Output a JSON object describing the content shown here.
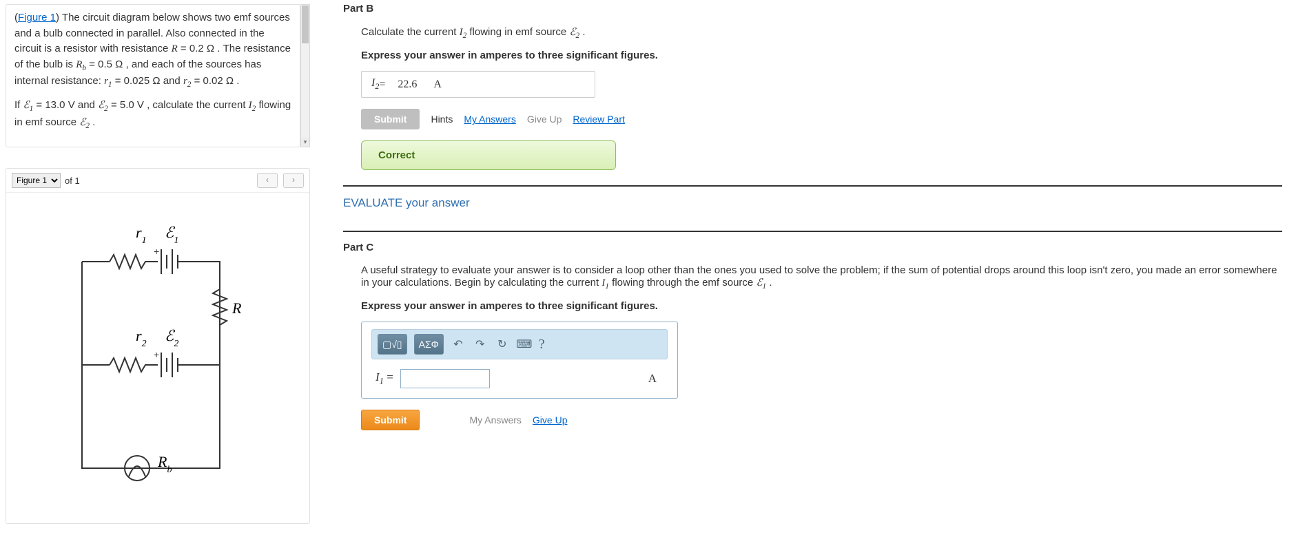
{
  "problem": {
    "figure_link": "Figure 1",
    "para1_a": ") The circuit diagram below shows two emf sources and a bulb connected in parallel. Also connected in the circuit is a resistor with resistance ",
    "R": "R",
    "eqR": " = 0.2 ",
    "ohm": "Ω",
    "para1_b": " . The resistance of the bulb is ",
    "Rb": "R",
    "Rb_sub": "b",
    "eqRb": " = 0.5 ",
    "para1_c": " , and each of the sources has internal resistance: ",
    "r1": "r",
    "r1_sub": "1",
    "eqr1": " = 0.025 ",
    "and": " and ",
    "r2": "r",
    "r2_sub": "2",
    "eqr2": " = 0.02 ",
    "period": " .",
    "para2_a": "If ",
    "E1": "ℰ",
    "E1_sub": "1",
    "eqE1": " = 13.0 V",
    "and2": " and ",
    "E2": "ℰ",
    "E2_sub": "2",
    "eqE2": " = 5.0 V",
    "para2_b": " , calculate the current ",
    "I2": "I",
    "I2_sub": "2",
    "para2_c": " flowing in emf source ",
    "E2b": "ℰ",
    "E2b_sub": "2",
    "period2": " ."
  },
  "figure": {
    "select_value": "Figure 1",
    "of_text": "of 1",
    "prev": "‹",
    "next": "›",
    "labels": {
      "r1": "r₁",
      "E1": "ℰ₁",
      "r2": "r₂",
      "E2": "ℰ₂",
      "R": "R",
      "Rb": "R_b"
    }
  },
  "partB": {
    "title": "Part B",
    "instruction_a": "Calculate the current ",
    "I2": "I",
    "I2_sub": "2",
    "instruction_b": " flowing in emf source ",
    "E2": "ℰ",
    "E2_sub": "2",
    "period": " .",
    "bold": "Express your answer in amperes to three significant figures.",
    "ans_var": "I",
    "ans_sub": "2",
    "equals": " = ",
    "ans_value": "22.6",
    "ans_unit": "A",
    "submit": "Submit",
    "hints": "Hints",
    "my_answers": "My Answers",
    "give_up": "Give Up",
    "review": "Review Part",
    "correct": "Correct"
  },
  "evaluate": "EVALUATE your answer",
  "partC": {
    "title": "Part C",
    "para_a": "A useful strategy to evaluate your answer is to consider a loop other than the ones you used to solve the problem; if the sum of potential drops around this loop isn't zero, you made an error somewhere in your calculations. Begin by calculating the current ",
    "I1": "I",
    "I1_sub": "1",
    "para_b": " flowing through the emf source ",
    "E1": "ℰ",
    "E1_sub": "1",
    "period": " .",
    "bold": "Express your answer in amperes to three significant figures.",
    "toolbar": {
      "templates": "▢√▯",
      "greek": "ΑΣΦ",
      "undo": "↶",
      "redo": "↷",
      "reset": "↻",
      "keyboard": "⌨",
      "help": "?"
    },
    "ans_var": "I",
    "ans_sub": "1",
    "equals": " = ",
    "ans_value": "",
    "ans_unit": "A",
    "submit": "Submit",
    "my_answers": "My Answers",
    "give_up": "Give Up"
  }
}
